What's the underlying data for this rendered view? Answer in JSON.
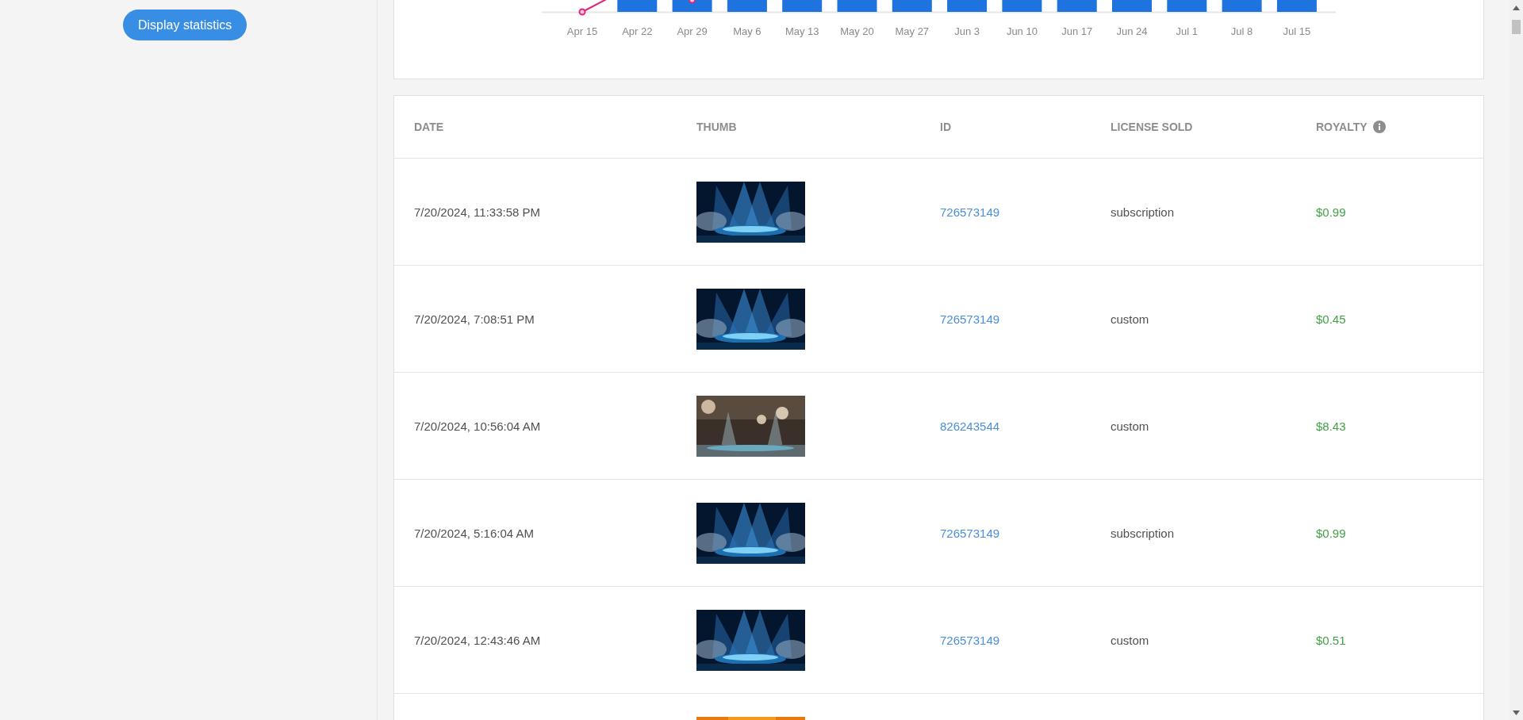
{
  "sidebar": {
    "button": "Display statistics"
  },
  "chart": {
    "x_labels": [
      "Apr 15",
      "Apr 22",
      "Apr 29",
      "May 6",
      "May 13",
      "May 20",
      "May 27",
      "Jun 3",
      "Jun 10",
      "Jun 17",
      "Jun 24",
      "Jul 1",
      "Jul 8",
      "Jul 15"
    ]
  },
  "table": {
    "columns": [
      {
        "label": "DATE"
      },
      {
        "label": "THUMB"
      },
      {
        "label": "ID"
      },
      {
        "label": "LICENSE SOLD"
      },
      {
        "label": "ROYALTY",
        "info": true
      }
    ],
    "rows": [
      {
        "date": "7/20/2024, 11:33:58 PM",
        "thumb": {
          "kind": "picture"
        },
        "id": "726573149",
        "license": "subscription",
        "royalty": "$0.99"
      },
      {
        "date": "7/20/2024, 7:08:51 PM",
        "thumb": {
          "kind": "picture"
        },
        "id": "726573149",
        "license": "custom",
        "royalty": "$0.45"
      },
      {
        "date": "7/20/2024, 10:56:04 AM",
        "thumb": {
          "kind": "picture"
        },
        "id": "826243544",
        "license": "custom",
        "royalty": "$8.43"
      },
      {
        "date": "7/20/2024, 5:16:04 AM",
        "thumb": {
          "kind": "picture"
        },
        "id": "726573149",
        "license": "subscription",
        "royalty": "$0.99"
      },
      {
        "date": "7/20/2024, 12:43:46 AM",
        "thumb": {
          "kind": "picture"
        },
        "id": "726573149",
        "license": "custom",
        "royalty": "$0.51"
      },
      {
        "thumb": {
          "kind": "picture"
        }
      }
    ]
  }
}
